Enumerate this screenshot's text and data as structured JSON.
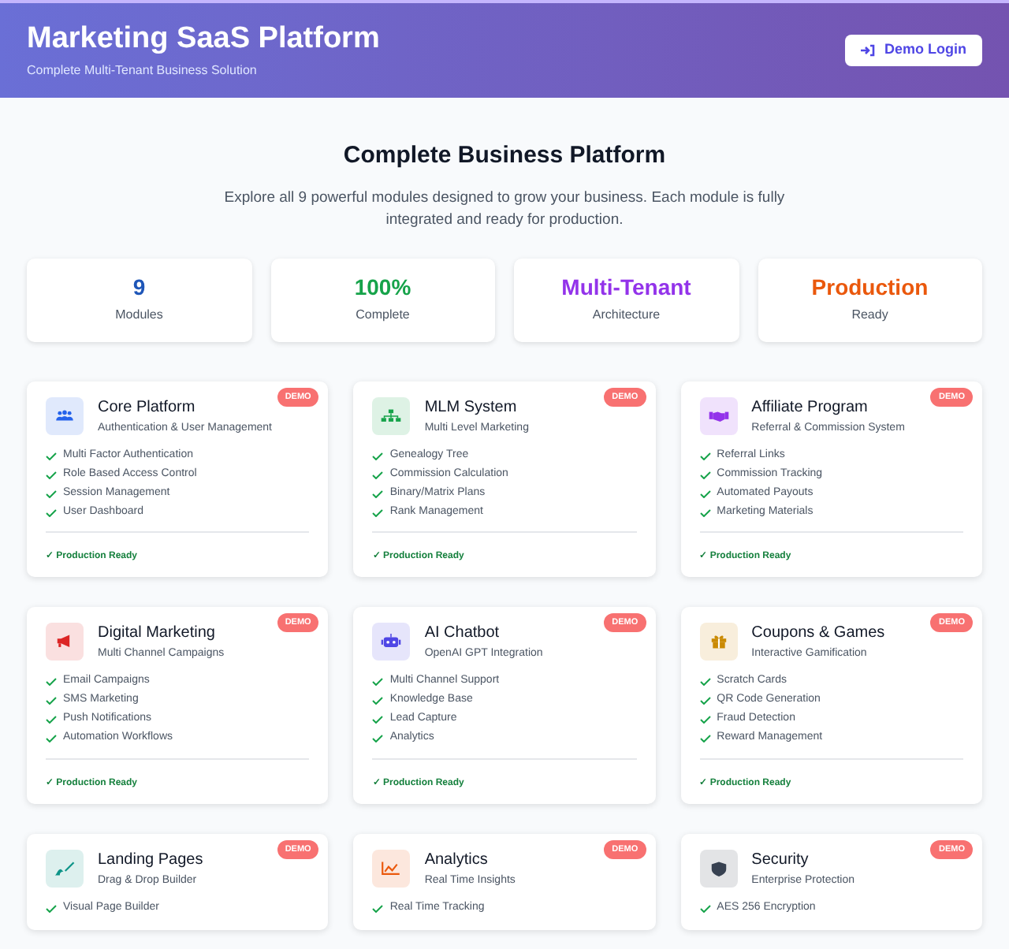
{
  "header": {
    "title": "Marketing SaaS Platform",
    "subtitle": "Complete Multi-Tenant Business Solution",
    "login_button": "Demo Login"
  },
  "intro": {
    "heading": "Complete Business Platform",
    "text": "Explore all 9 powerful modules designed to grow your business. Each module is fully integrated and ready for production."
  },
  "stats": [
    {
      "value": "9",
      "label": "Modules",
      "color": "#1e56b8"
    },
    {
      "value": "100%",
      "label": "Complete",
      "color": "#16a34a"
    },
    {
      "value": "Multi-Tenant",
      "label": "Architecture",
      "color": "#9333ea"
    },
    {
      "value": "Production",
      "label": "Ready",
      "color": "#ea580c"
    }
  ],
  "modules": [
    {
      "kind": "users",
      "color": "#2563eb",
      "title": "Core Platform",
      "subtitle": "Authentication & User Management",
      "badge": "DEMO",
      "features": [
        "Multi Factor Authentication",
        "Role Based Access Control",
        "Session Management",
        "User Dashboard"
      ],
      "status": "✓ Production Ready"
    },
    {
      "kind": "sitemap",
      "color": "#16a34a",
      "title": "MLM System",
      "subtitle": "Multi Level Marketing",
      "badge": "DEMO",
      "features": [
        "Genealogy Tree",
        "Commission Calculation",
        "Binary/Matrix Plans",
        "Rank Management"
      ],
      "status": "✓ Production Ready"
    },
    {
      "kind": "handshake",
      "color": "#9333ea",
      "title": "Affiliate Program",
      "subtitle": "Referral & Commission System",
      "badge": "DEMO",
      "features": [
        "Referral Links",
        "Commission Tracking",
        "Automated Payouts",
        "Marketing Materials"
      ],
      "status": "✓ Production Ready"
    },
    {
      "kind": "megaphone",
      "color": "#dc2626",
      "title": "Digital Marketing",
      "subtitle": "Multi Channel Campaigns",
      "badge": "DEMO",
      "features": [
        "Email Campaigns",
        "SMS Marketing",
        "Push Notifications",
        "Automation Workflows"
      ],
      "status": "✓ Production Ready"
    },
    {
      "kind": "robot",
      "color": "#4f46e5",
      "title": "AI Chatbot",
      "subtitle": "OpenAI GPT Integration",
      "badge": "DEMO",
      "features": [
        "Multi Channel Support",
        "Knowledge Base",
        "Lead Capture",
        "Analytics"
      ],
      "status": "✓ Production Ready"
    },
    {
      "kind": "gift",
      "color": "#ca8a04",
      "title": "Coupons & Games",
      "subtitle": "Interactive Gamification",
      "badge": "DEMO",
      "features": [
        "Scratch Cards",
        "QR Code Generation",
        "Fraud Detection",
        "Reward Management"
      ],
      "status": "✓ Production Ready"
    },
    {
      "kind": "brush",
      "color": "#0d9488",
      "title": "Landing Pages",
      "subtitle": "Drag & Drop Builder",
      "badge": "DEMO",
      "features": [
        "Visual Page Builder"
      ]
    },
    {
      "kind": "chart",
      "color": "#ea580c",
      "title": "Analytics",
      "subtitle": "Real Time Insights",
      "badge": "DEMO",
      "features": [
        "Real Time Tracking"
      ]
    },
    {
      "kind": "shield",
      "color": "#374151",
      "title": "Security",
      "subtitle": "Enterprise Protection",
      "badge": "DEMO",
      "features": [
        "AES 256 Encryption"
      ]
    }
  ]
}
